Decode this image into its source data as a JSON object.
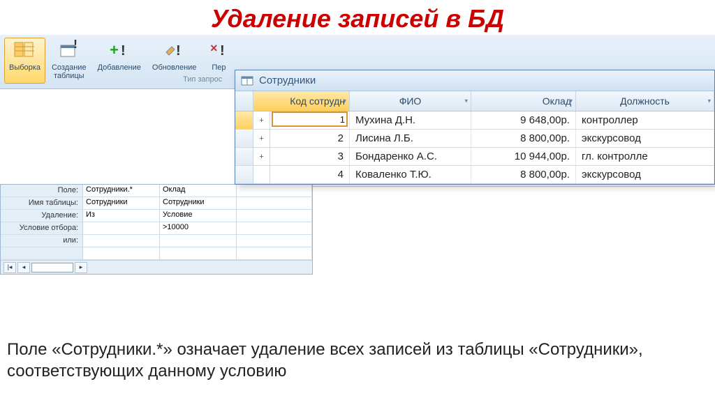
{
  "title": "Удаление записей в БД",
  "ribbon": {
    "items": [
      {
        "label": "Выборка"
      },
      {
        "label": "Создание\nтаблицы"
      },
      {
        "label": "Добавление"
      },
      {
        "label": "Обновление"
      },
      {
        "label": "Пер"
      }
    ],
    "tip_label": "Тип запрос"
  },
  "grid": {
    "labels": {
      "field": "Поле:",
      "table": "Имя таблицы:",
      "delete": "Удаление:",
      "criteria": "Условие отбора:",
      "or": "или:"
    },
    "cols": [
      {
        "field": "Сотрудники.*",
        "table": "Сотрудники",
        "delete": "Из",
        "criteria": ""
      },
      {
        "field": "Оклад",
        "table": "Сотрудники",
        "delete": "Условие",
        "criteria": ">10000"
      }
    ]
  },
  "datasheet": {
    "title": "Сотрудники",
    "headers": {
      "id": "Код сотрудн",
      "fio": "ФИО",
      "oklad": "Оклад",
      "pos": "Должность"
    },
    "rows": [
      {
        "id": "1",
        "fio": "Мухина Д.Н.",
        "oklad": "9 648,00р.",
        "pos": "контроллер",
        "editing": true,
        "editval": ""
      },
      {
        "id": "2",
        "fio": "Лисина Л.Б.",
        "oklad": "8 800,00р.",
        "pos": "экскурсовод"
      },
      {
        "id": "3",
        "fio": "Бондаренко А.С.",
        "oklad": "10 944,00р.",
        "pos": "гл. контролле"
      },
      {
        "id": "4",
        "fio": "Коваленко Т.Ю.",
        "oklad": "8 800,00р.",
        "pos": "экскурсовод"
      }
    ]
  },
  "footer": "Поле «Сотрудники.*» означает удаление всех записей из таблицы «Сотрудники», соответствующих данному условию"
}
